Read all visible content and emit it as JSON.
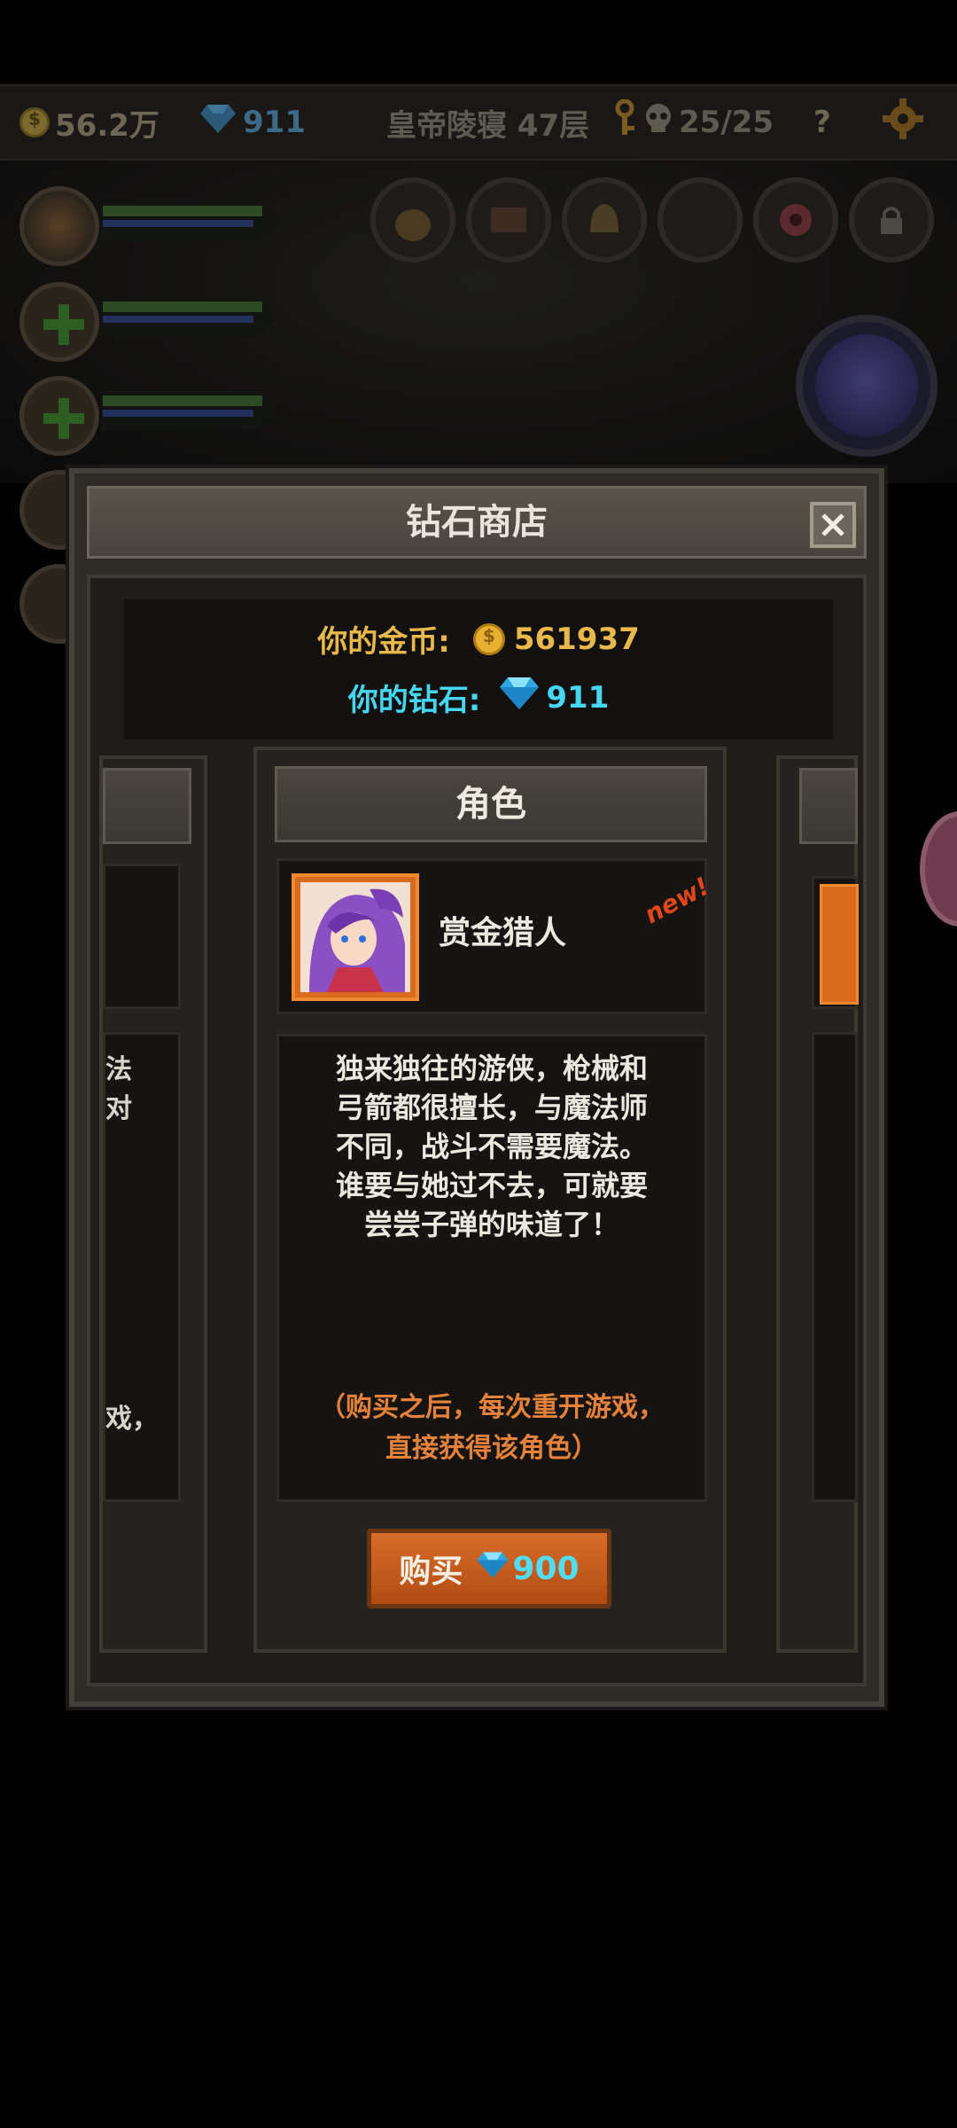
{
  "status_bar": {
    "gold": "56.2万",
    "diamonds": "911",
    "floor": "皇帝陵寝 47层",
    "kills": "25/25",
    "help_label": "?"
  },
  "shop": {
    "title": "钻石商店",
    "gold_label": "你的金币:",
    "gold_value": "561937",
    "diamond_label": "你的钻石:",
    "diamond_value": "911",
    "card": {
      "category": "角色",
      "name": "赏金猎人",
      "badge": "new!",
      "description": "独来独往的游侠，枪械和\n弓箭都很擅长，与魔法师\n不同，战斗不需要魔法。\n谁要与她过不去，可就要\n尝尝子弹的味道了！",
      "note": "（购买之后，每次重开游戏，\n直接获得该角色）",
      "buy_label": "购买",
      "price": "900"
    },
    "left_card_fragment": {
      "desc_lines": "法\n对",
      "note_fragment": "戏，"
    }
  },
  "colors": {
    "gold": "#e8b84b",
    "diamond": "#46d6f2",
    "button": "#c35a1c",
    "new_badge": "#e0461c",
    "note": "#e4813a"
  }
}
